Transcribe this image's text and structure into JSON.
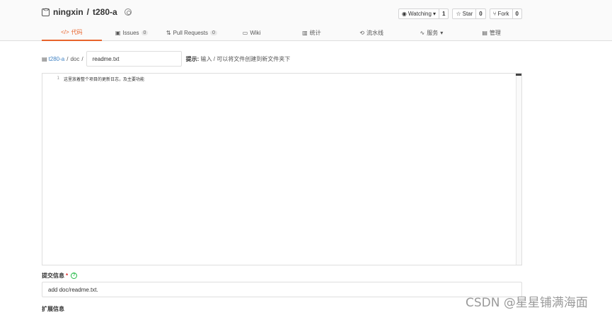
{
  "repo": {
    "owner": "ningxin",
    "separator": "/",
    "name": "t280-a"
  },
  "actions": [
    {
      "label": "Watching",
      "icon": "eye-icon",
      "caret": "▾",
      "count": "1"
    },
    {
      "label": "Star",
      "icon": "star-icon",
      "count": "0"
    },
    {
      "label": "Fork",
      "icon": "fork-icon",
      "count": "0"
    }
  ],
  "tabs": [
    {
      "label": "代码",
      "icon": "code-icon",
      "glyph": "</>",
      "active": true
    },
    {
      "label": "Issues",
      "icon": "issues-icon",
      "glyph": "▣",
      "count": "0"
    },
    {
      "label": "Pull Requests",
      "icon": "pull-request-icon",
      "glyph": "⇅",
      "count": "0"
    },
    {
      "label": "Wiki",
      "icon": "wiki-icon",
      "glyph": "▭"
    },
    {
      "label": "统计",
      "icon": "stats-icon",
      "glyph": "▥"
    },
    {
      "label": "流水线",
      "icon": "pipeline-icon",
      "glyph": "⟲"
    },
    {
      "label": "服务",
      "icon": "service-icon",
      "glyph": "∿",
      "caret": "▾"
    },
    {
      "label": "管理",
      "icon": "manage-icon",
      "glyph": "▤"
    }
  ],
  "breadcrumb": {
    "root": "t280-a",
    "sep1": "/",
    "folder": "doc",
    "sep2": "/"
  },
  "file_name": "readme.txt",
  "hint": {
    "title": "提示:",
    "text": "输入 / 可以将文件创建到新文件夹下"
  },
  "editor": {
    "line_number": "1",
    "content": "这里放着整个项目的更新日志，及主要功能"
  },
  "commit": {
    "label": "提交信息",
    "required_mark": "*",
    "help_glyph": "?",
    "value": "add doc/readme.txt."
  },
  "extended_label": "扩展信息",
  "watermark": "CSDN @星星铺满海面",
  "colors": {
    "accent": "#e8642c",
    "link": "#4183c4",
    "help": "#21ba45",
    "required": "#db2828"
  }
}
